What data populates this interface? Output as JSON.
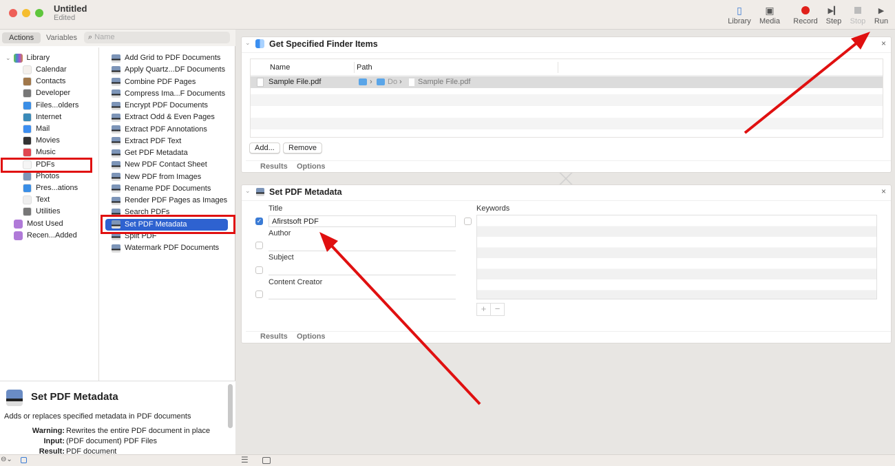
{
  "window": {
    "title": "Untitled",
    "subtitle": "Edited"
  },
  "toolbar": [
    {
      "label": "Library",
      "icon": "sidebar-icon"
    },
    {
      "label": "Media",
      "icon": "photos-icon"
    },
    {
      "label": "Record",
      "icon": "record-icon",
      "color": "#e0201a"
    },
    {
      "label": "Step",
      "icon": "step-icon"
    },
    {
      "label": "Stop",
      "icon": "stop-icon",
      "disabled": true
    },
    {
      "label": "Run",
      "icon": "play-icon"
    }
  ],
  "left": {
    "tabs": {
      "actions": "Actions",
      "variables": "Variables"
    },
    "search_placeholder": "Name",
    "library": {
      "label": "Library",
      "items": [
        {
          "label": "Calendar",
          "color": "#f4f0ec"
        },
        {
          "label": "Contacts",
          "color": "#a0774a"
        },
        {
          "label": "Developer",
          "color": "#777"
        },
        {
          "label": "Files...olders",
          "color": "#3a8ee6"
        },
        {
          "label": "Internet",
          "color": "#3a8ab8"
        },
        {
          "label": "Mail",
          "color": "#3d8ef0"
        },
        {
          "label": "Movies",
          "color": "#333"
        },
        {
          "label": "Music",
          "color": "#e0454f"
        },
        {
          "label": "PDFs",
          "color": "#f5f5f5"
        },
        {
          "label": "Photos",
          "color": "#7d95b8"
        },
        {
          "label": "Pres...ations",
          "color": "#3a8ee6"
        },
        {
          "label": "Text",
          "color": "#eee"
        },
        {
          "label": "Utilities",
          "color": "#777"
        }
      ],
      "extra": [
        {
          "label": "Most Used"
        },
        {
          "label": "Recen...Added"
        }
      ]
    },
    "actions": [
      "Add Grid to PDF Documents",
      "Apply Quartz...DF Documents",
      "Combine PDF Pages",
      "Compress Ima...F Documents",
      "Encrypt PDF Documents",
      "Extract Odd & Even Pages",
      "Extract PDF Annotations",
      "Extract PDF Text",
      "Get PDF Metadata",
      "New PDF Contact Sheet",
      "New PDF from Images",
      "Rename PDF Documents",
      "Render PDF Pages as Images",
      "Search PDFs",
      "Set PDF Metadata",
      "Split PDF",
      "Watermark PDF Documents"
    ],
    "selected_action": "Set PDF Metadata",
    "description": {
      "title": "Set PDF Metadata",
      "summary": "Adds or replaces specified metadata in PDF documents",
      "warning_label": "Warning:",
      "warning": "Rewrites the entire PDF document in place",
      "input_label": "Input:",
      "input": "(PDF document) PDF Files",
      "result_label": "Result:",
      "result": "PDF document"
    }
  },
  "workflow": {
    "finder": {
      "title": "Get Specified Finder Items",
      "col_name": "Name",
      "col_path": "Path",
      "file": "Sample File.pdf",
      "path_mid": "Do",
      "path_file": "Sample File.pdf",
      "add": "Add...",
      "remove": "Remove",
      "results": "Results",
      "options": "Options"
    },
    "metadata": {
      "title": "Set PDF Metadata",
      "title_label": "Title",
      "title_value": "Afirstsoft PDF",
      "title_checked": true,
      "author_label": "Author",
      "subject_label": "Subject",
      "creator_label": "Content Creator",
      "keywords_label": "Keywords",
      "plus": "+",
      "minus": "−",
      "results": "Results",
      "options": "Options"
    }
  },
  "annotation_color": "#e01010"
}
